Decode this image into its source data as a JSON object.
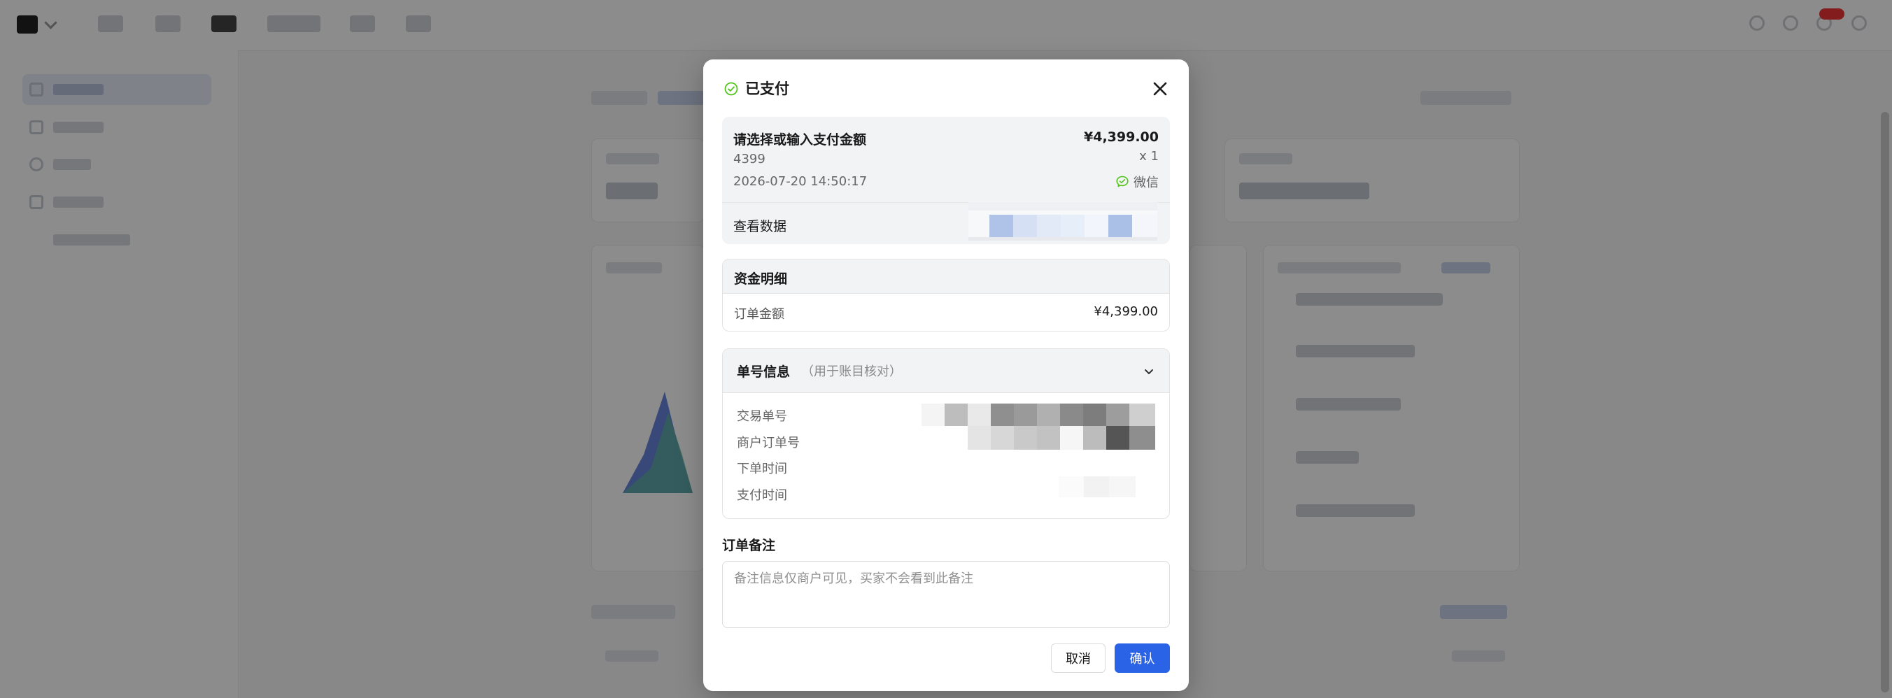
{
  "modal": {
    "title": "已支付",
    "summary": {
      "label": "请选择或输入支付金额",
      "amount": "¥4,399.00",
      "code": "4399",
      "quantity": "x 1",
      "datetime": "2026-07-20 14:50:17",
      "pay_method": "微信",
      "view_data": "查看数据"
    },
    "funds": {
      "header": "资金明细",
      "row_label": "订单金额",
      "row_value": "¥4,399.00"
    },
    "order_info": {
      "header": "单号信息",
      "note": "（用于账目核对）",
      "rows": [
        "交易单号",
        "商户订单号",
        "下单时间",
        "支付时间"
      ]
    },
    "remark": {
      "label": "订单备注",
      "placeholder": "备注信息仅商户可见，买家不会看到此备注"
    },
    "buttons": {
      "cancel": "取消",
      "confirm": "确认"
    }
  },
  "colors": {
    "primary": "#2b63e6",
    "success": "#52c41a"
  },
  "icons": [
    "check-circle-icon",
    "close-icon",
    "wechat-icon",
    "chevron-down-icon"
  ]
}
